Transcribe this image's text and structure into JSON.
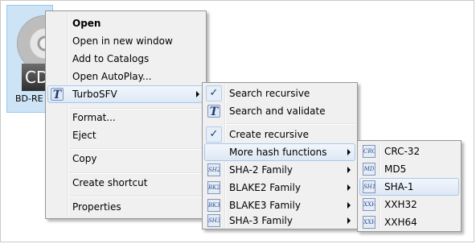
{
  "desktop": {
    "disc_label": "CD-",
    "disc_name": "BD-RE MP"
  },
  "main_menu": {
    "items": [
      {
        "label": "Open"
      },
      {
        "label": "Open in new window"
      },
      {
        "label": "Add to Catalogs"
      },
      {
        "label": "Open AutoPlay..."
      },
      {
        "label": "TurboSFV",
        "icon_text": "T"
      },
      {
        "label": "Format..."
      },
      {
        "label": "Eject"
      },
      {
        "label": "Copy"
      },
      {
        "label": "Create shortcut"
      },
      {
        "label": "Properties"
      }
    ]
  },
  "turbosfv_menu": {
    "items": [
      {
        "label": "Search recursive",
        "check": "✓"
      },
      {
        "label": "Search and validate",
        "icon_text": "T"
      },
      {
        "label": "Create recursive",
        "check": "✓"
      },
      {
        "label": "More hash functions"
      },
      {
        "label": "SHA-2 Family",
        "icon_text": "SH2"
      },
      {
        "label": "BLAKE2 Family",
        "icon_text": "BK2"
      },
      {
        "label": "BLAKE3 Family",
        "icon_text": "BK3"
      },
      {
        "label": "SHA-3 Family",
        "icon_text": "SH3"
      }
    ]
  },
  "hash_menu": {
    "items": [
      {
        "label": "CRC-32",
        "icon_text": "CRC"
      },
      {
        "label": "MD5",
        "icon_text": "MD"
      },
      {
        "label": "SHA-1",
        "icon_text": "SH1"
      },
      {
        "label": "XXH32",
        "icon_text": "XXH"
      },
      {
        "label": "XXH64",
        "icon_text": "XXH"
      }
    ]
  },
  "colors": {
    "menu_bg": "#f0f0f0",
    "highlight_border": "#a8c8ec",
    "selection_tile": "#cde4f7"
  }
}
